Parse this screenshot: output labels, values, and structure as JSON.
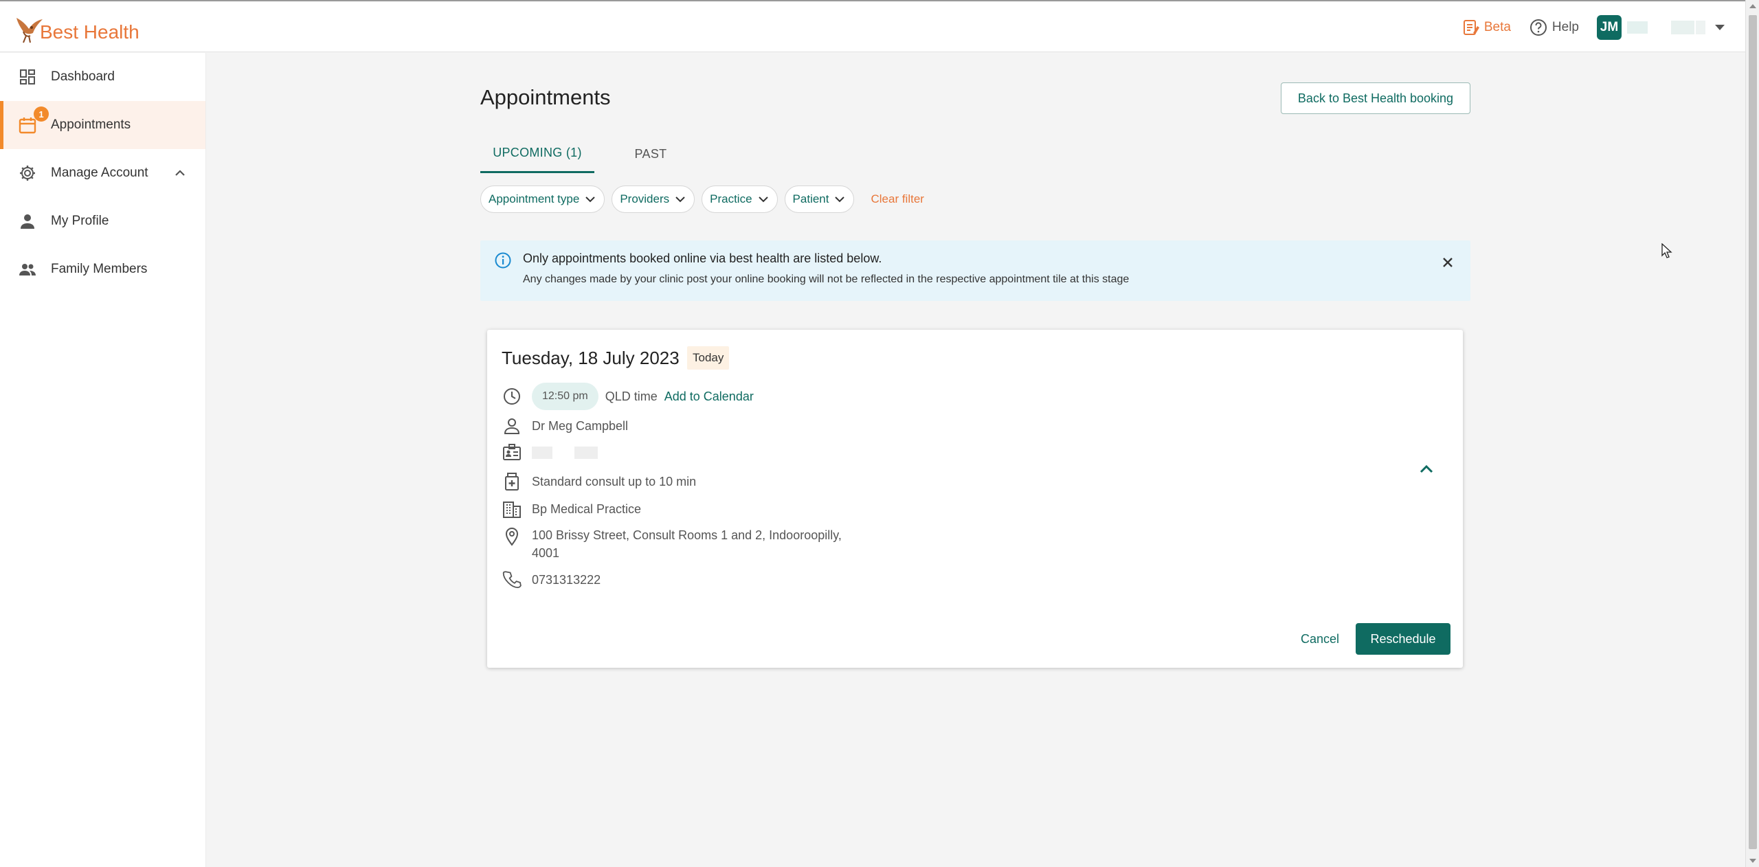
{
  "brand": {
    "name": "Best Health"
  },
  "header": {
    "beta_label": "Beta",
    "help_label": "Help",
    "avatar_initials": "JM"
  },
  "sidebar": {
    "items": [
      {
        "label": "Dashboard",
        "icon": "dashboard-icon"
      },
      {
        "label": "Appointments",
        "icon": "calendar-icon",
        "badge": "1",
        "active": true
      },
      {
        "label": "Manage Account",
        "icon": "gear-icon",
        "expanded": true
      },
      {
        "label": "My Profile",
        "icon": "person-icon"
      },
      {
        "label": "Family Members",
        "icon": "people-icon"
      }
    ]
  },
  "main": {
    "title": "Appointments",
    "back_button": "Back to Best Health booking",
    "tabs": [
      {
        "label": "UPCOMING (1)",
        "active": true
      },
      {
        "label": "PAST",
        "active": false
      }
    ],
    "filters": [
      {
        "label": "Appointment type"
      },
      {
        "label": "Providers"
      },
      {
        "label": "Practice"
      },
      {
        "label": "Patient"
      }
    ],
    "clear_filter": "Clear filter",
    "info": {
      "title": "Only appointments booked online via best health are listed below.",
      "subtitle": "Any changes made by your clinic post your online booking will not be reflected in the respective appointment tile at this stage"
    },
    "appointment": {
      "date": "Tuesday, 18 July 2023",
      "badge": "Today",
      "time": "12:50 pm",
      "timezone": "QLD time",
      "add_to_calendar": "Add to Calendar",
      "provider": "Dr Meg Campbell",
      "appointment_type": "Standard consult up to 10 min",
      "practice": "Bp Medical Practice",
      "address_line1": "100 Brissy Street, Consult Rooms 1 and 2, Indooroopilly,",
      "address_line2": "4001",
      "phone": "0731313222",
      "cancel_label": "Cancel",
      "reschedule_label": "Reschedule"
    }
  },
  "colors": {
    "primary": "#0f6b61",
    "accent": "#e8773a",
    "badge": "#f28a2b",
    "info_bg": "#e6f4fa"
  }
}
